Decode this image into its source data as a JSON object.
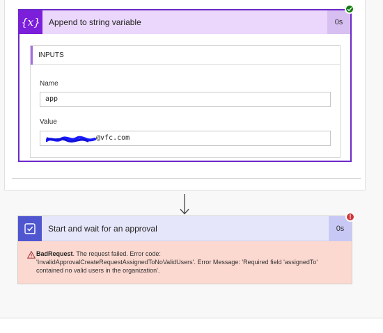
{
  "append_card": {
    "title": "Append to string variable",
    "duration": "0s",
    "icon": "variable-braces-icon",
    "icon_glyph": "{x}",
    "status": "succeeded",
    "inputs_header": "INPUTS",
    "name_label": "Name",
    "name_value": "app",
    "value_label": "Value",
    "value_value": "@vfc.com",
    "accent": "#7b1fdb"
  },
  "approval_card": {
    "title": "Start and wait for an approval",
    "duration": "0s",
    "icon": "approval-check-icon",
    "status": "failed",
    "status_glyph": "!",
    "error_title": "BadRequest",
    "error_message": ". The request failed. Error code: 'InvalidApprovalCreateRequestAssignedToNoValidUsers'. Error Message: 'Required field 'assignedTo' contained no valid users in the organization'.",
    "accent": "#4f56cf",
    "error_bg": "#fbd8d0"
  }
}
